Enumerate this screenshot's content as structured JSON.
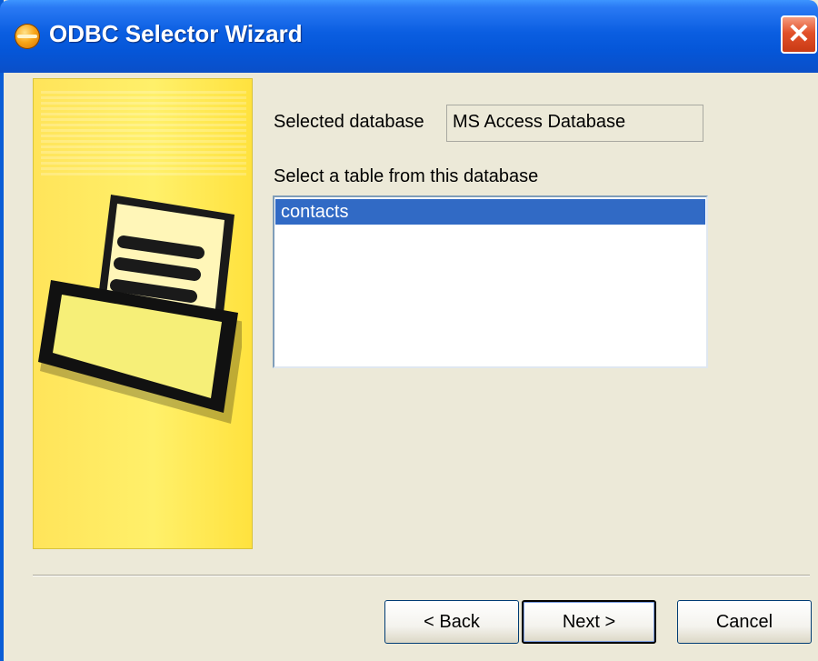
{
  "window": {
    "title": "ODBC Selector Wizard",
    "close_symbol": "✕"
  },
  "form": {
    "selected_database_label": "Selected database",
    "selected_database_value": "MS Access Database",
    "table_prompt": "Select a table from this database",
    "tables": [
      "contacts"
    ],
    "selected_table": "contacts"
  },
  "buttons": {
    "back": "< Back",
    "next": "Next >",
    "cancel": "Cancel"
  },
  "colors": {
    "titlebar": "#0556d8",
    "selection": "#316ac5",
    "side_panel": "#fff06a"
  },
  "icons": {
    "app": "odbc-app-icon",
    "close": "close-icon",
    "wizard": "document-tray-icon"
  }
}
